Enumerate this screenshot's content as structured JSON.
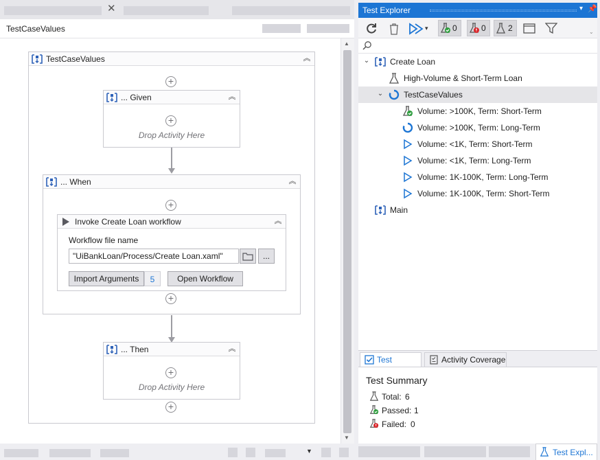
{
  "designer": {
    "title": "TestCaseValues",
    "outer_sequence": "TestCaseValues",
    "given": {
      "title": "... Given",
      "drop": "Drop Activity Here"
    },
    "when": {
      "title": "... When",
      "invoke": {
        "title": "Invoke Create Loan workflow",
        "file_label": "Workflow file name",
        "file_value": "\"UiBankLoan/Process/Create Loan.xaml\"",
        "ellipsis": "...",
        "import_label": "Import Arguments",
        "import_count": "5",
        "open_label": "Open Workflow"
      }
    },
    "then": {
      "title": "... Then",
      "drop": "Drop Activity Here"
    }
  },
  "test_explorer": {
    "title": "Test Explorer",
    "counts": {
      "passed": "0",
      "failed": "0",
      "total": "2"
    },
    "tree": [
      {
        "label": "Create Loan",
        "icon": "sequence-icon"
      },
      {
        "label": "High-Volume & Short-Term Loan",
        "icon": "flask-icon"
      },
      {
        "label": "TestCaseValues",
        "icon": "spinner-icon"
      },
      {
        "label": "Volume: >100K, Term: Short-Term",
        "icon": "flask-passed-icon"
      },
      {
        "label": "Volume: >100K, Term: Long-Term",
        "icon": "spinner-icon"
      },
      {
        "label": "Volume: <1K, Term: Short-Term",
        "icon": "play-outline-icon"
      },
      {
        "label": "Volume: <1K, Term: Long-Term",
        "icon": "play-outline-icon"
      },
      {
        "label": "Volume: 1K-100K, Term: Long-Term",
        "icon": "play-outline-icon"
      },
      {
        "label": "Volume: 1K-100K, Term: Short-Term",
        "icon": "play-outline-icon"
      },
      {
        "label": "Main",
        "icon": "sequence-icon"
      }
    ],
    "tabs": {
      "results": "Test Results",
      "coverage": "Activity Coverage"
    },
    "summary": {
      "title": "Test Summary",
      "total_label": "Total:",
      "total_value": "6",
      "passed_label": "Passed:",
      "passed_value": "1",
      "failed_label": "Failed:",
      "failed_value": "0"
    },
    "bottom_tab": "Test Expl..."
  },
  "colors": {
    "accent": "#1c75d4",
    "passed": "#2e9e3e",
    "failed": "#d9262b"
  }
}
